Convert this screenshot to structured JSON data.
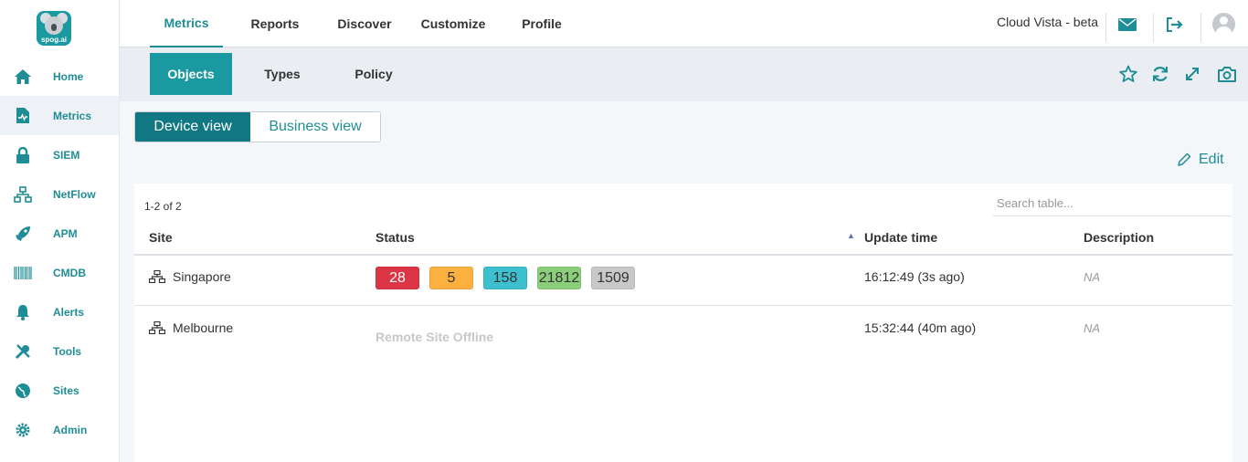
{
  "logo": {
    "text": "spog.ai"
  },
  "sidebar": {
    "items": [
      {
        "label": "Home",
        "icon": "home-icon"
      },
      {
        "label": "Metrics",
        "icon": "metrics-icon",
        "active": true
      },
      {
        "label": "SIEM",
        "icon": "lock-icon"
      },
      {
        "label": "NetFlow",
        "icon": "network-icon"
      },
      {
        "label": "APM",
        "icon": "rocket-icon"
      },
      {
        "label": "CMDB",
        "icon": "barcode-icon"
      },
      {
        "label": "Alerts",
        "icon": "bell-icon"
      },
      {
        "label": "Tools",
        "icon": "tools-icon"
      },
      {
        "label": "Sites",
        "icon": "globe-icon"
      },
      {
        "label": "Admin",
        "icon": "gear-icon"
      }
    ]
  },
  "topnav": {
    "tabs": [
      {
        "label": "Metrics",
        "active": true
      },
      {
        "label": "Reports"
      },
      {
        "label": "Discover"
      },
      {
        "label": "Customize"
      },
      {
        "label": "Profile"
      }
    ],
    "brand": "Cloud Vista - beta"
  },
  "subnav": {
    "tabs": [
      {
        "label": "Objects",
        "active": true
      },
      {
        "label": "Types"
      },
      {
        "label": "Policy"
      }
    ]
  },
  "view_toggle": {
    "device": "Device view",
    "business": "Business view",
    "selected": "Device view"
  },
  "edit_label": "Edit",
  "table": {
    "count": "1-2 of 2",
    "search_placeholder": "Search table...",
    "columns": [
      "Site",
      "Status",
      "Update time",
      "Description"
    ],
    "sort_column": "Update time",
    "rows": [
      {
        "site": "Singapore",
        "status": [
          {
            "value": "28",
            "color": "#dc3545"
          },
          {
            "value": "5",
            "color": "#fbb040"
          },
          {
            "value": "158",
            "color": "#3cbfcf"
          },
          {
            "value": "21812",
            "color": "#8ccf7a"
          },
          {
            "value": "1509",
            "color": "#c8c8c8"
          }
        ],
        "update_time": "16:12:49 (3s ago)",
        "description": "NA"
      },
      {
        "site": "Melbourne",
        "status_text": "Remote Site Offline",
        "update_time": "15:32:44 (40m ago)",
        "description": "NA"
      }
    ]
  },
  "colors": {
    "accent": "#1a9aa0",
    "accent_dark": "#117782",
    "text_accent": "#1f8d95"
  }
}
